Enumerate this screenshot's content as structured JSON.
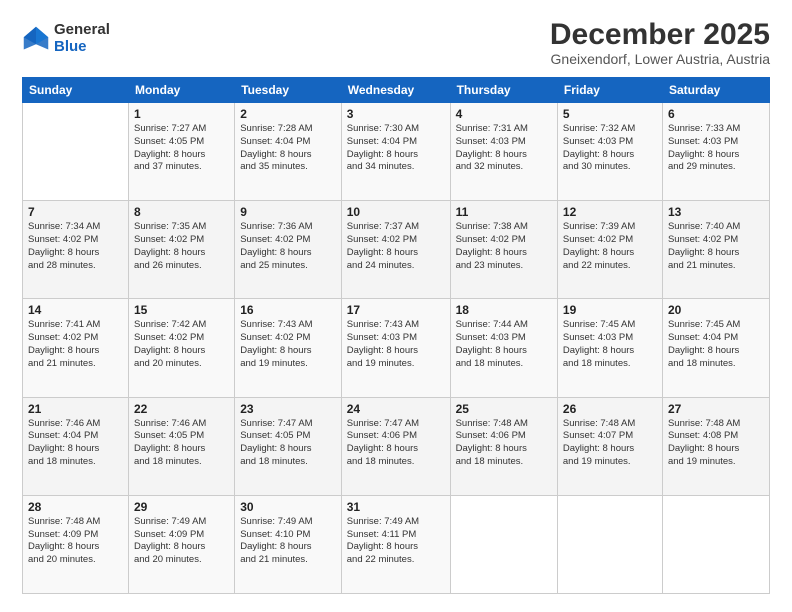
{
  "logo": {
    "general": "General",
    "blue": "Blue"
  },
  "header": {
    "title": "December 2025",
    "subtitle": "Gneixendorf, Lower Austria, Austria"
  },
  "days_of_week": [
    "Sunday",
    "Monday",
    "Tuesday",
    "Wednesday",
    "Thursday",
    "Friday",
    "Saturday"
  ],
  "weeks": [
    [
      {
        "day": "",
        "info": ""
      },
      {
        "day": "1",
        "info": "Sunrise: 7:27 AM\nSunset: 4:05 PM\nDaylight: 8 hours\nand 37 minutes."
      },
      {
        "day": "2",
        "info": "Sunrise: 7:28 AM\nSunset: 4:04 PM\nDaylight: 8 hours\nand 35 minutes."
      },
      {
        "day": "3",
        "info": "Sunrise: 7:30 AM\nSunset: 4:04 PM\nDaylight: 8 hours\nand 34 minutes."
      },
      {
        "day": "4",
        "info": "Sunrise: 7:31 AM\nSunset: 4:03 PM\nDaylight: 8 hours\nand 32 minutes."
      },
      {
        "day": "5",
        "info": "Sunrise: 7:32 AM\nSunset: 4:03 PM\nDaylight: 8 hours\nand 30 minutes."
      },
      {
        "day": "6",
        "info": "Sunrise: 7:33 AM\nSunset: 4:03 PM\nDaylight: 8 hours\nand 29 minutes."
      }
    ],
    [
      {
        "day": "7",
        "info": "Sunrise: 7:34 AM\nSunset: 4:02 PM\nDaylight: 8 hours\nand 28 minutes."
      },
      {
        "day": "8",
        "info": "Sunrise: 7:35 AM\nSunset: 4:02 PM\nDaylight: 8 hours\nand 26 minutes."
      },
      {
        "day": "9",
        "info": "Sunrise: 7:36 AM\nSunset: 4:02 PM\nDaylight: 8 hours\nand 25 minutes."
      },
      {
        "day": "10",
        "info": "Sunrise: 7:37 AM\nSunset: 4:02 PM\nDaylight: 8 hours\nand 24 minutes."
      },
      {
        "day": "11",
        "info": "Sunrise: 7:38 AM\nSunset: 4:02 PM\nDaylight: 8 hours\nand 23 minutes."
      },
      {
        "day": "12",
        "info": "Sunrise: 7:39 AM\nSunset: 4:02 PM\nDaylight: 8 hours\nand 22 minutes."
      },
      {
        "day": "13",
        "info": "Sunrise: 7:40 AM\nSunset: 4:02 PM\nDaylight: 8 hours\nand 21 minutes."
      }
    ],
    [
      {
        "day": "14",
        "info": "Sunrise: 7:41 AM\nSunset: 4:02 PM\nDaylight: 8 hours\nand 21 minutes."
      },
      {
        "day": "15",
        "info": "Sunrise: 7:42 AM\nSunset: 4:02 PM\nDaylight: 8 hours\nand 20 minutes."
      },
      {
        "day": "16",
        "info": "Sunrise: 7:43 AM\nSunset: 4:02 PM\nDaylight: 8 hours\nand 19 minutes."
      },
      {
        "day": "17",
        "info": "Sunrise: 7:43 AM\nSunset: 4:03 PM\nDaylight: 8 hours\nand 19 minutes."
      },
      {
        "day": "18",
        "info": "Sunrise: 7:44 AM\nSunset: 4:03 PM\nDaylight: 8 hours\nand 18 minutes."
      },
      {
        "day": "19",
        "info": "Sunrise: 7:45 AM\nSunset: 4:03 PM\nDaylight: 8 hours\nand 18 minutes."
      },
      {
        "day": "20",
        "info": "Sunrise: 7:45 AM\nSunset: 4:04 PM\nDaylight: 8 hours\nand 18 minutes."
      }
    ],
    [
      {
        "day": "21",
        "info": "Sunrise: 7:46 AM\nSunset: 4:04 PM\nDaylight: 8 hours\nand 18 minutes."
      },
      {
        "day": "22",
        "info": "Sunrise: 7:46 AM\nSunset: 4:05 PM\nDaylight: 8 hours\nand 18 minutes."
      },
      {
        "day": "23",
        "info": "Sunrise: 7:47 AM\nSunset: 4:05 PM\nDaylight: 8 hours\nand 18 minutes."
      },
      {
        "day": "24",
        "info": "Sunrise: 7:47 AM\nSunset: 4:06 PM\nDaylight: 8 hours\nand 18 minutes."
      },
      {
        "day": "25",
        "info": "Sunrise: 7:48 AM\nSunset: 4:06 PM\nDaylight: 8 hours\nand 18 minutes."
      },
      {
        "day": "26",
        "info": "Sunrise: 7:48 AM\nSunset: 4:07 PM\nDaylight: 8 hours\nand 19 minutes."
      },
      {
        "day": "27",
        "info": "Sunrise: 7:48 AM\nSunset: 4:08 PM\nDaylight: 8 hours\nand 19 minutes."
      }
    ],
    [
      {
        "day": "28",
        "info": "Sunrise: 7:48 AM\nSunset: 4:09 PM\nDaylight: 8 hours\nand 20 minutes."
      },
      {
        "day": "29",
        "info": "Sunrise: 7:49 AM\nSunset: 4:09 PM\nDaylight: 8 hours\nand 20 minutes."
      },
      {
        "day": "30",
        "info": "Sunrise: 7:49 AM\nSunset: 4:10 PM\nDaylight: 8 hours\nand 21 minutes."
      },
      {
        "day": "31",
        "info": "Sunrise: 7:49 AM\nSunset: 4:11 PM\nDaylight: 8 hours\nand 22 minutes."
      },
      {
        "day": "",
        "info": ""
      },
      {
        "day": "",
        "info": ""
      },
      {
        "day": "",
        "info": ""
      }
    ]
  ]
}
